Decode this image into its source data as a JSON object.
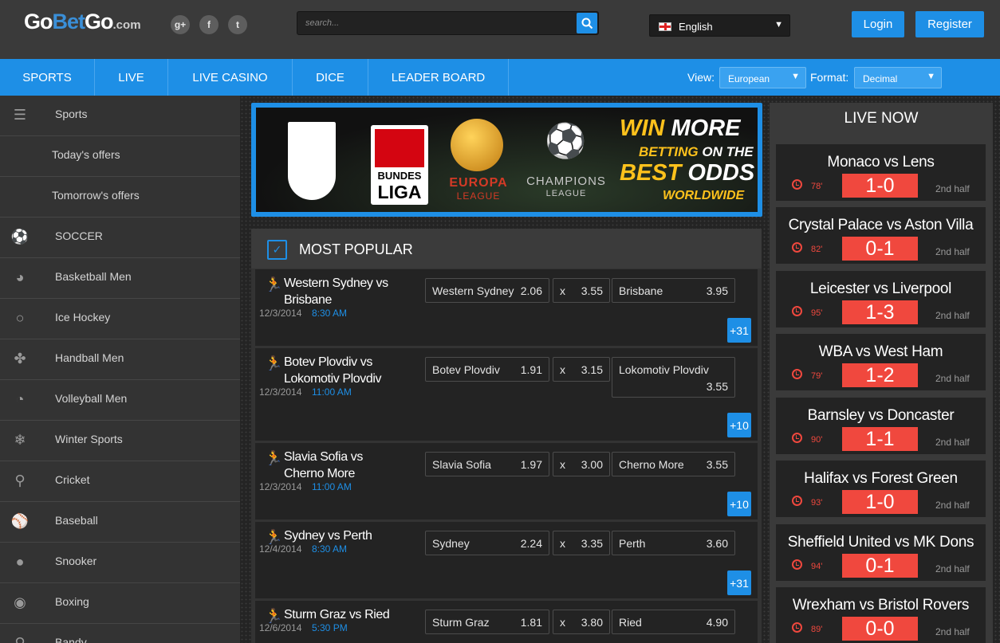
{
  "header": {
    "logo": {
      "part1": "Go",
      "part2": "Bet",
      "part3": "Go",
      "domain": ".com"
    },
    "social": [
      {
        "name": "google-plus-icon",
        "glyph": "g+"
      },
      {
        "name": "facebook-icon",
        "glyph": "f"
      },
      {
        "name": "twitter-icon",
        "glyph": "t"
      }
    ],
    "search_placeholder": "search...",
    "language": "English",
    "login_label": "Login",
    "register_label": "Register"
  },
  "nav": {
    "items": [
      "SPORTS",
      "LIVE",
      "LIVE CASINO",
      "DICE",
      "LEADER BOARD"
    ],
    "view_label": "View:",
    "view_value": "European",
    "format_label": "Format:",
    "format_value": "Decimal"
  },
  "sidebar": {
    "items": [
      {
        "label": "Sports",
        "icon": "menu-icon"
      },
      {
        "label": "Today's offers",
        "icon": ""
      },
      {
        "label": "Tomorrow's offers",
        "icon": ""
      },
      {
        "label": "SOCCER",
        "icon": "soccer-ball-icon"
      },
      {
        "label": "Basketball Men",
        "icon": "basketball-icon"
      },
      {
        "label": "Ice Hockey",
        "icon": "hockey-icon"
      },
      {
        "label": "Handball Men",
        "icon": "handball-icon"
      },
      {
        "label": "Volleyball Men",
        "icon": "volleyball-icon"
      },
      {
        "label": "Winter Sports",
        "icon": "winter-sports-icon"
      },
      {
        "label": "Cricket",
        "icon": "cricket-icon"
      },
      {
        "label": "Baseball",
        "icon": "baseball-icon"
      },
      {
        "label": "Snooker",
        "icon": "snooker-icon"
      },
      {
        "label": "Boxing",
        "icon": "boxing-icon"
      },
      {
        "label": "Bandy",
        "icon": "bandy-icon"
      }
    ]
  },
  "banner": {
    "bundes1": "BUNDES",
    "bundes2": "LIGA",
    "europa1": "EUROPA",
    "europa2": "LEAGUE",
    "champions1": "CHAMPIONS",
    "champions2": "LEAGUE",
    "line1a": "WIN",
    "line1b": "MORE",
    "line2a": "BETTING",
    "line2b": "ON THE",
    "line3a": "BEST",
    "line3b": "ODDS",
    "line4": "WORLDWIDE"
  },
  "most_popular": {
    "title": "MOST POPULAR",
    "matches": [
      {
        "name": "Western Sydney vs Brisbane",
        "date": "12/3/2014",
        "time": "8:30 AM",
        "home": "Western Sydney",
        "home_odd": "2.06",
        "draw": "x",
        "draw_odd": "3.55",
        "away": "Brisbane",
        "away_odd": "3.95",
        "more": "+31"
      },
      {
        "name": "Botev Plovdiv vs Lokomotiv Plovdiv",
        "date": "12/3/2014",
        "time": "11:00 AM",
        "home": "Botev Plovdiv",
        "home_odd": "1.91",
        "draw": "x",
        "draw_odd": "3.15",
        "away": "Lokomotiv Plovdiv",
        "away_odd": "3.55",
        "more": "+10"
      },
      {
        "name": "Slavia Sofia vs Cherno More",
        "date": "12/3/2014",
        "time": "11:00 AM",
        "home": "Slavia Sofia",
        "home_odd": "1.97",
        "draw": "x",
        "draw_odd": "3.00",
        "away": "Cherno More",
        "away_odd": "3.55",
        "more": "+10"
      },
      {
        "name": "Sydney vs Perth",
        "date": "12/4/2014",
        "time": "8:30 AM",
        "home": "Sydney",
        "home_odd": "2.24",
        "draw": "x",
        "draw_odd": "3.35",
        "away": "Perth",
        "away_odd": "3.60",
        "more": "+31"
      },
      {
        "name": "Sturm Graz vs Ried",
        "date": "12/6/2014",
        "time": "5:30 PM",
        "home": "Sturm Graz",
        "home_odd": "1.81",
        "draw": "x",
        "draw_odd": "3.80",
        "away": "Ried",
        "away_odd": "4.90",
        "more": ""
      }
    ]
  },
  "live_now": {
    "title": "LIVE NOW",
    "games": [
      {
        "teams": "Monaco vs Lens",
        "minute": "78'",
        "score": "1-0",
        "period": "2nd half"
      },
      {
        "teams": "Crystal Palace vs Aston Villa",
        "minute": "82'",
        "score": "0-1",
        "period": "2nd half"
      },
      {
        "teams": "Leicester vs Liverpool",
        "minute": "95'",
        "score": "1-3",
        "period": "2nd half"
      },
      {
        "teams": "WBA vs West Ham",
        "minute": "79'",
        "score": "1-2",
        "period": "2nd half"
      },
      {
        "teams": "Barnsley vs Doncaster",
        "minute": "90'",
        "score": "1-1",
        "period": "2nd half"
      },
      {
        "teams": "Halifax vs Forest Green",
        "minute": "93'",
        "score": "1-0",
        "period": "2nd half"
      },
      {
        "teams": "Sheffield United vs MK Dons",
        "minute": "94'",
        "score": "0-1",
        "period": "2nd half"
      },
      {
        "teams": "Wrexham vs Bristol Rovers",
        "minute": "89'",
        "score": "0-0",
        "period": "2nd half"
      }
    ]
  },
  "colors": {
    "accent": "#1e8fe6",
    "live_red": "#f0483e",
    "banner_gold": "#ffc21c"
  }
}
